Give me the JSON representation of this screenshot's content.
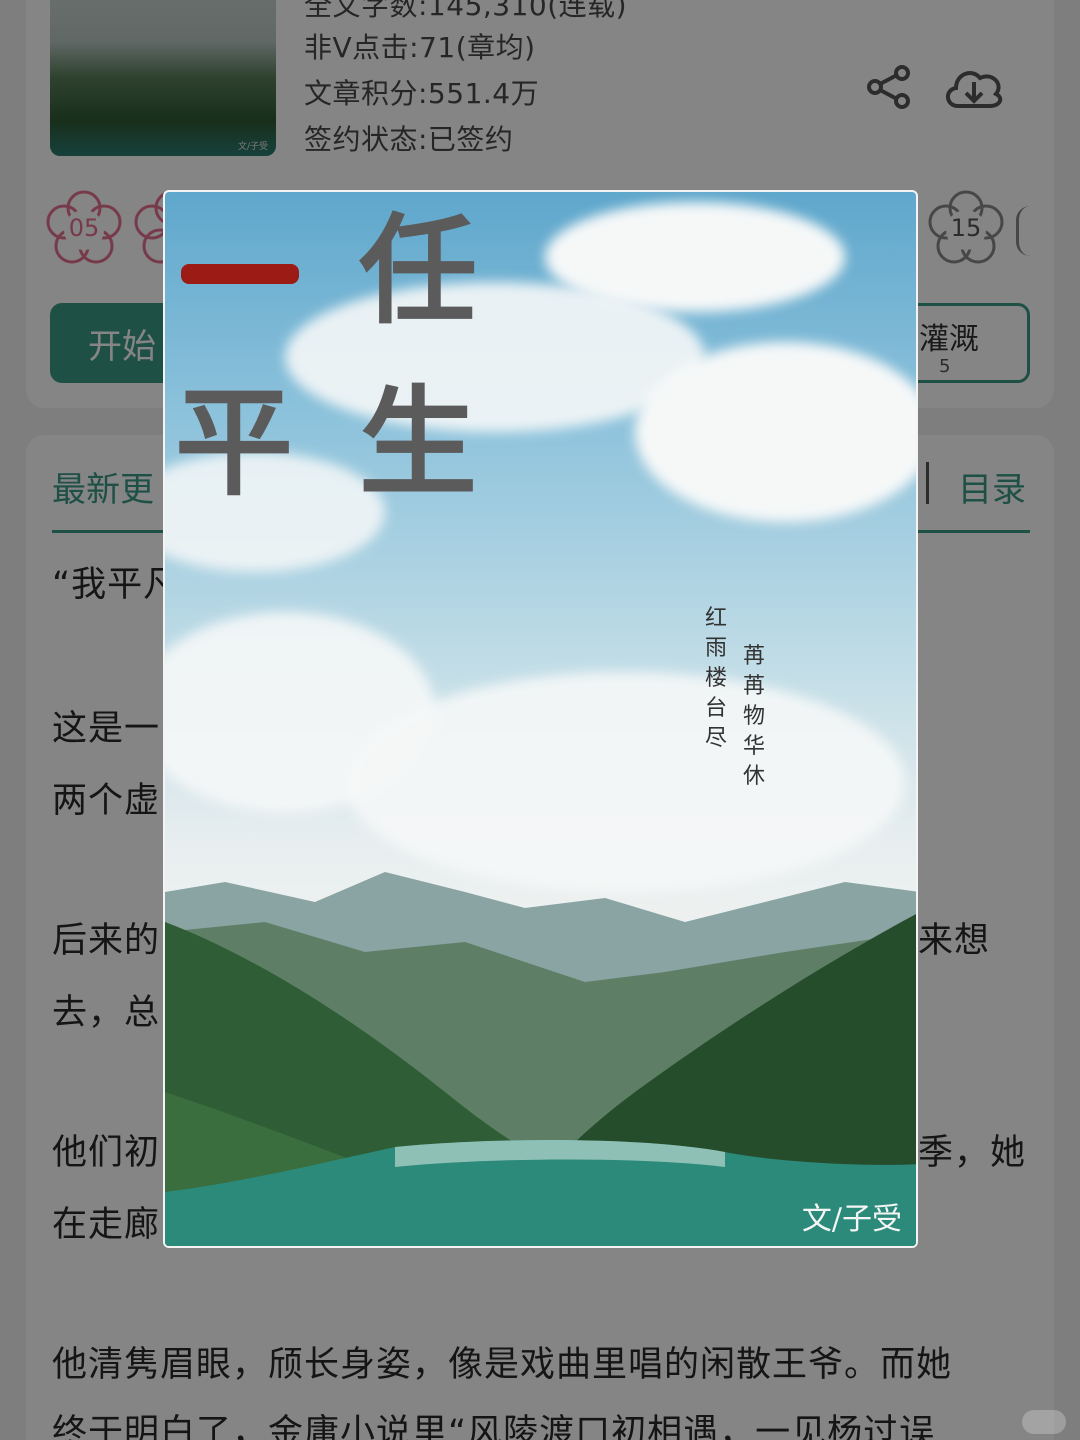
{
  "book_info": {
    "thumb_author": "文/子受",
    "word_count": "全文字数:145,310(连载)",
    "non_v_clicks": "非Ⅴ点击:71(章均)",
    "score": "文章积分:551.4万",
    "sign_status": "签约状态:已签约",
    "share_icon": "share-icon",
    "download_icon": "download-icon"
  },
  "rewards": {
    "left_count": "05",
    "right_count": "15"
  },
  "actions": {
    "start_reading": "开始",
    "irrigate_label": "灌溉",
    "irrigate_count": "5"
  },
  "tabs": {
    "latest_update": "最新更",
    "catalog": "目录"
  },
  "chapter_preview": {
    "lines": [
      "“我平凡",
      "这是一",
      "两个虚",
      "后来的",
      "去，总",
      "他们初",
      "在走廊",
      "他清隽眉眼，颀长身姿，像是戏曲里唱的闲散王爷。而她",
      "终于明白了，金庸小说里“风陵渡口初相遇，一见杨过误"
    ],
    "fragment_right_1": "来想",
    "fragment_right_2": "季，她"
  },
  "cover": {
    "title_chars": [
      "一",
      "任",
      "平",
      "生"
    ],
    "poem_col_1": [
      "红",
      "雨",
      "楼",
      "台",
      "尽"
    ],
    "poem_col_2": [
      "苒",
      "苒",
      "物",
      "华",
      "休"
    ],
    "author": "文/子受"
  },
  "colors": {
    "accent": "#3d9a86",
    "pink": "#e56f8f",
    "title_red": "#9c1b15"
  }
}
